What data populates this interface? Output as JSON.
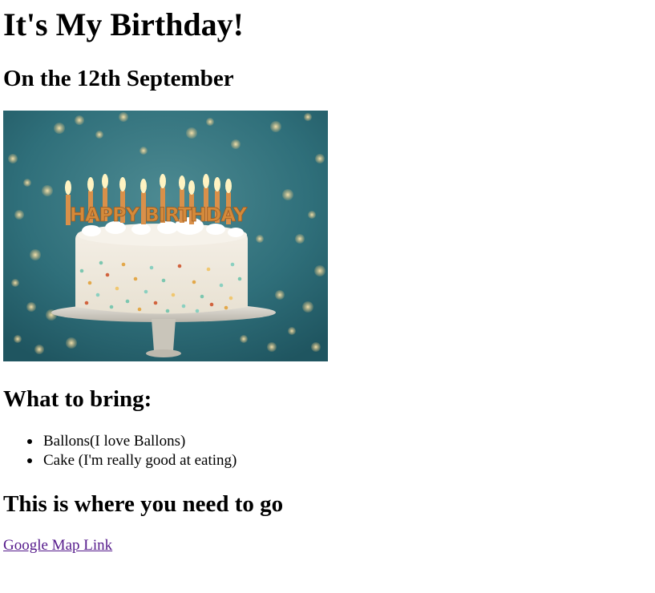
{
  "heading": "It's My Birthday!",
  "date_heading": "On the 12th September",
  "image": {
    "name": "birthday-cake-photo",
    "cake_topper_text": "HAPPY BIRTHDAY",
    "colors": {
      "background": "#2f6f7a",
      "frosting": "#f2ede3",
      "candle_letters": "#d48a3a"
    }
  },
  "bring_heading": "What to bring:",
  "bring_items": [
    "Ballons(I love Ballons)",
    "Cake (I'm really good at eating)"
  ],
  "location_heading": "This is where you need to go",
  "map_link_text": "Google Map Link",
  "link_color": "#551a8b"
}
